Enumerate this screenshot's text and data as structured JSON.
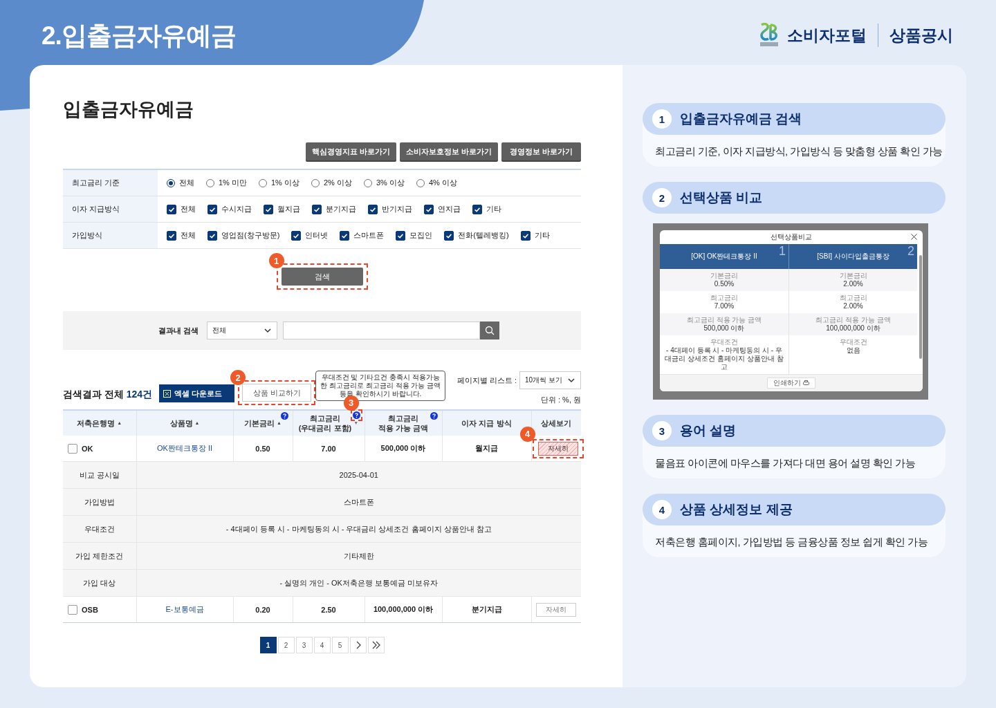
{
  "page_title": "2.입출금자유예금",
  "brand": {
    "name": "소비자포털",
    "section": "상품공시"
  },
  "main": {
    "heading": "입출금자유예금",
    "link_buttons": [
      "핵심경영지표 바로가기",
      "소비자보호정보 바로가기",
      "경영정보 바로가기"
    ],
    "filters": [
      {
        "label": "최고금리 기준",
        "kind": "radio",
        "options": [
          {
            "label": "전체",
            "selected": true
          },
          {
            "label": "1% 미만",
            "selected": false
          },
          {
            "label": "1% 이상",
            "selected": false
          },
          {
            "label": "2% 이상",
            "selected": false
          },
          {
            "label": "3% 이상",
            "selected": false
          },
          {
            "label": "4% 이상",
            "selected": false
          }
        ]
      },
      {
        "label": "이자 지급방식",
        "kind": "checkbox",
        "options": [
          {
            "label": "전체",
            "checked": true
          },
          {
            "label": "수시지급",
            "checked": true
          },
          {
            "label": "월지급",
            "checked": true
          },
          {
            "label": "분기지급",
            "checked": true
          },
          {
            "label": "반기지급",
            "checked": true
          },
          {
            "label": "연지급",
            "checked": true
          },
          {
            "label": "기타",
            "checked": true
          }
        ]
      },
      {
        "label": "가입방식",
        "kind": "checkbox",
        "options": [
          {
            "label": "전체",
            "checked": true
          },
          {
            "label": "영업점(창구방문)",
            "checked": true
          },
          {
            "label": "인터넷",
            "checked": true
          },
          {
            "label": "스마트폰",
            "checked": true
          },
          {
            "label": "모집인",
            "checked": true
          },
          {
            "label": "전화(텔레뱅킹)",
            "checked": true
          },
          {
            "label": "기타",
            "checked": true
          }
        ]
      }
    ],
    "search_button": {
      "label": "검색",
      "marker": "1"
    },
    "result_search": {
      "label": "결과내 검색",
      "scope": "전체"
    },
    "results": {
      "title": "검색결과 전체",
      "count": "124건",
      "excel_button": "엑셀 다운로드",
      "compare_button": {
        "label": "상품 비교하기",
        "marker": "2"
      },
      "tooltip": "우대조건 및 기타요건 충족시 적용가능한 최고금리로 최고금리 적용 가능 금액 등을 확인하시기 바랍니다.",
      "page_size_label": "페이지별 리스트 :",
      "page_size": "10개씩 보기",
      "unit": "단위 : %, 원"
    },
    "table": {
      "columns": [
        {
          "label": "저축은행명",
          "sort_arrow": "▲",
          "help": false
        },
        {
          "label": "상품명",
          "sort_arrow": "▲",
          "help": false
        },
        {
          "label": "기본금리",
          "sort_arrow": "▲",
          "help": true
        },
        {
          "label": "최고금리\n(우대금리 포함)",
          "sort_arrow": "▼",
          "help": true,
          "marker": "3"
        },
        {
          "label": "최고금리\n적용 가능 금액",
          "help": true
        },
        {
          "label": "이자 지급 방식",
          "help": false
        },
        {
          "label": "상세보기",
          "help": false
        }
      ],
      "rows": [
        {
          "checked": false,
          "bank": "OK",
          "product": "OK짠테크통장 II",
          "base_rate": "0.50",
          "max_rate": "7.00",
          "max_amount": "500,000 이하",
          "payment": "월지급",
          "detail": {
            "label": "자세히",
            "highlighted": true,
            "marker": "4"
          },
          "expanded": true,
          "details": [
            {
              "label": "비교 공시일",
              "value": "2025-04-01"
            },
            {
              "label": "가입방법",
              "value": "스마트폰"
            },
            {
              "label": "우대조건",
              "value": "- 4대페이 등록 시 - 마케팅동의 시 - 우대금리 상세조건 홈페이지 상품안내 참고"
            },
            {
              "label": "가입 제한조건",
              "value": "기타제한"
            },
            {
              "label": "가입 대상",
              "value": "- 실명의 개인 - OK저축은행 보통예금 미보유자"
            }
          ]
        },
        {
          "checked": false,
          "bank": "OSB",
          "product": "E-보통예금",
          "base_rate": "0.20",
          "max_rate": "2.50",
          "max_amount": "100,000,000 이하",
          "payment": "분기지급",
          "detail": {
            "label": "자세히",
            "highlighted": false
          },
          "expanded": false
        }
      ]
    },
    "pagination": [
      {
        "label": "1",
        "selected": true
      },
      {
        "label": "2",
        "selected": false
      },
      {
        "label": "3",
        "selected": false
      },
      {
        "label": "4",
        "selected": false
      },
      {
        "label": "5",
        "selected": false
      }
    ]
  },
  "guide": {
    "steps": [
      {
        "number": "1",
        "title": "입출금자유예금 검색",
        "kind": "text",
        "description": "최고금리 기준, 이자 지급방식, 가입방식 등 맞춤형 상품 확인 가능"
      },
      {
        "number": "2",
        "title": "선택상품 비교",
        "kind": "preview",
        "preview": {
          "title": "선택상품비교",
          "print_button": "인쇄하기",
          "products": [
            {
              "number": "1",
              "name": "[OK] OK짠테크통장 II",
              "fields": [
                {
                  "label": "기본금리",
                  "value": "0.50%"
                },
                {
                  "label": "최고금리",
                  "value": "7.00%"
                },
                {
                  "label": "최고금리 적용 가능 금액",
                  "value": "500,000 이하"
                },
                {
                  "label": "우대조건",
                  "value": "- 4대페이 등록 시 - 마케팅동의 시 - 우대금리 상세조건 홈페이지 상품안내 참고"
                }
              ]
            },
            {
              "number": "2",
              "name": "[SBI] 사이다입출금통장",
              "fields": [
                {
                  "label": "기본금리",
                  "value": "2.00%"
                },
                {
                  "label": "최고금리",
                  "value": "2.00%"
                },
                {
                  "label": "최고금리 적용 가능 금액",
                  "value": "100,000,000 이하"
                },
                {
                  "label": "우대조건",
                  "value": "없음"
                }
              ]
            }
          ]
        }
      },
      {
        "number": "3",
        "title": "용어 설명",
        "kind": "text",
        "description": "물음표 아이콘에 마우스를 가져다 대면 용어 설명 확인 가능"
      },
      {
        "number": "4",
        "title": "상품 상세정보 제공",
        "kind": "text",
        "description": "저축은행 홈페이지, 가입방법 등 금융상품 정보 쉽게 확인 가능"
      }
    ]
  }
}
